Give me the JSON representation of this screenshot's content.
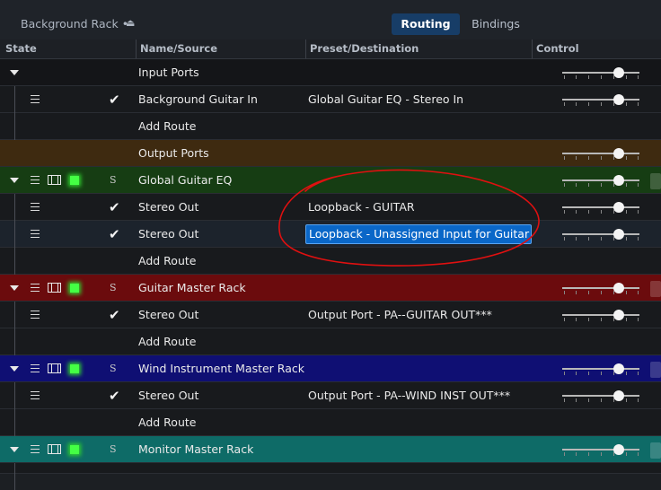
{
  "header": {
    "rack_title": "Background Rack •",
    "eject_glyph": "⏏",
    "tabs": [
      {
        "label": "Routing",
        "active": true
      },
      {
        "label": "Bindings",
        "active": false
      }
    ]
  },
  "columns": [
    "State",
    "Name/Source",
    "Preset/Destination",
    "Control"
  ],
  "rows": [
    {
      "kind": "group",
      "name": "Input Ports"
    },
    {
      "kind": "route",
      "name": "Background Guitar In",
      "destination": "Global Guitar EQ - Stereo In"
    },
    {
      "kind": "add",
      "name": "Add Route"
    },
    {
      "kind": "group",
      "name": "Output Ports"
    },
    {
      "kind": "rack",
      "name": "Global Guitar EQ",
      "badge": "S"
    },
    {
      "kind": "route",
      "name": "Stereo Out",
      "destination": "Loopback - GUITAR"
    },
    {
      "kind": "route",
      "name": "Stereo Out",
      "destination": "Loopback - Unassigned Input for Guitar",
      "selected": true
    },
    {
      "kind": "add",
      "name": "Add Route"
    },
    {
      "kind": "rack",
      "name": "Guitar Master Rack",
      "badge": "S"
    },
    {
      "kind": "route",
      "name": "Stereo Out",
      "destination": "Output Port - PA--GUITAR OUT***"
    },
    {
      "kind": "add",
      "name": "Add Route"
    },
    {
      "kind": "rack",
      "name": "Wind Instrument Master Rack",
      "badge": "S"
    },
    {
      "kind": "route",
      "name": "Stereo Out",
      "destination": "Output Port - PA--WIND INST OUT***"
    },
    {
      "kind": "add",
      "name": "Add Route"
    },
    {
      "kind": "rack",
      "name": "Monitor Master Rack",
      "badge": "S"
    }
  ],
  "colors": {
    "input_ports": "#141518",
    "output_ports": "#3e2a10",
    "global_guitar_eq": "#163d13",
    "guitar_master_rack": "#6b0b0d",
    "wind_instrument_master_rack": "#0f0f73",
    "monitor_master_rack": "#0e6b67",
    "annotation": "#e01010",
    "selection": "#0a67c8"
  },
  "annotation": {
    "shape": "freehand-ellipse",
    "color": "#e01010"
  }
}
